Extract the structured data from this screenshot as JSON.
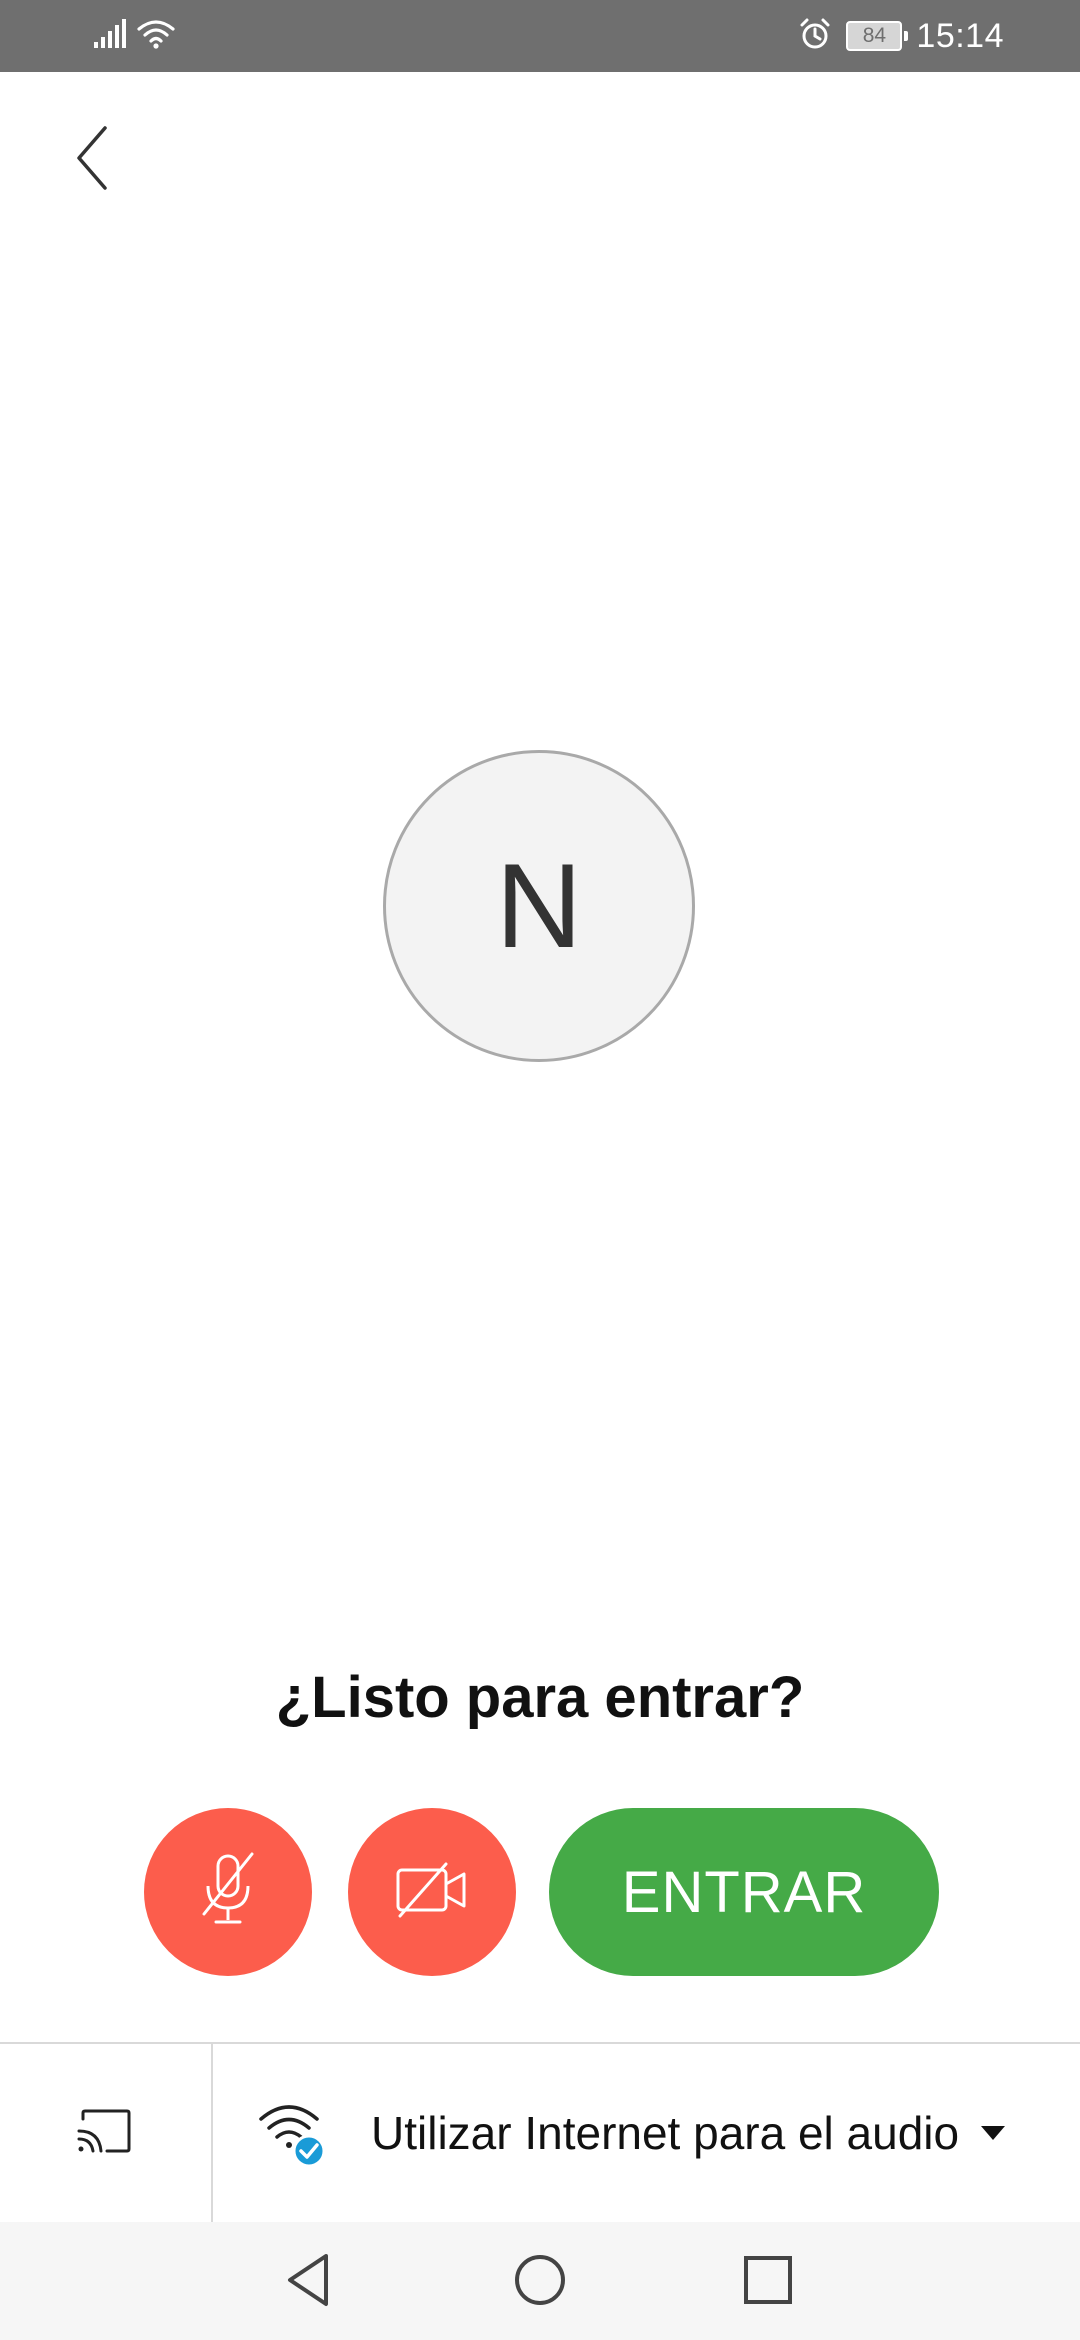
{
  "status_bar": {
    "battery_level": "84",
    "time": "15:14",
    "icons": [
      "signal-icon",
      "wifi-icon",
      "alarm-icon",
      "battery-icon"
    ]
  },
  "header": {
    "back_icon": "chevron-left-icon"
  },
  "avatar": {
    "initial": "N"
  },
  "prompt": {
    "title": "¿Listo para entrar?"
  },
  "controls": {
    "mic_icon": "mic-muted-icon",
    "camera_icon": "camera-off-icon",
    "join_label": "ENTRAR",
    "mute_color": "#fc5d4c",
    "join_color": "#45aa47"
  },
  "audio_bar": {
    "cast_icon": "cast-icon",
    "audio_icon": "wifi-check-icon",
    "audio_label": "Utilizar Internet para el audio",
    "accent_color": "#1a9bd7"
  },
  "nav_bar": {
    "items": [
      "back-triangle-icon",
      "home-circle-icon",
      "recents-square-icon"
    ]
  }
}
